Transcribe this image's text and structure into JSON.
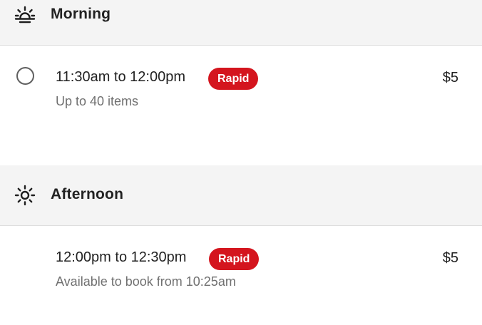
{
  "sections": [
    {
      "title": "Morning",
      "icon": "sunrise-icon",
      "slots": [
        {
          "time": "11:30am to 12:00pm",
          "badge": "Rapid",
          "price": "$5",
          "subtext": "Up to 40 items",
          "selectable": true
        }
      ]
    },
    {
      "title": "Afternoon",
      "icon": "sun-icon",
      "slots": [
        {
          "time": "12:00pm to 12:30pm",
          "badge": "Rapid",
          "price": "$5",
          "subtext": "Available to book from 10:25am",
          "selectable": false
        }
      ]
    }
  ],
  "colors": {
    "badge": "#d4151e",
    "header_bg": "#f4f4f4",
    "muted_text": "#707070"
  }
}
